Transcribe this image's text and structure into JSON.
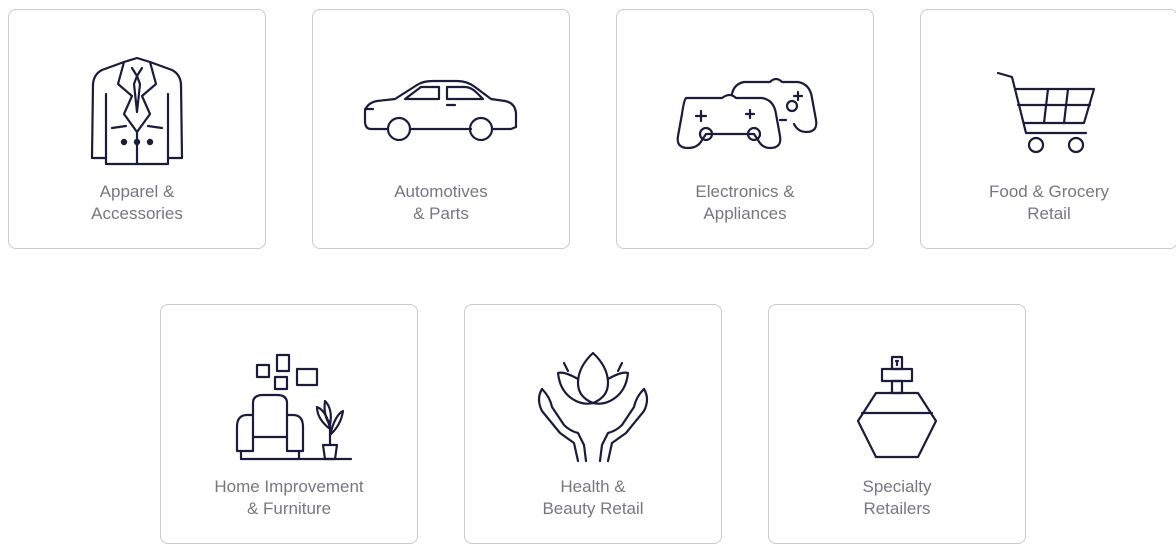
{
  "categories": [
    {
      "icon": "suit-jacket-icon",
      "line1": "Apparel &",
      "line2": "Accessories"
    },
    {
      "icon": "car-icon",
      "line1": "Automotives",
      "line2": "& Parts"
    },
    {
      "icon": "game-controllers-icon",
      "line1": "Electronics &",
      "line2": "Appliances"
    },
    {
      "icon": "shopping-cart-icon",
      "line1": "Food & Grocery",
      "line2": "Retail"
    },
    {
      "icon": "armchair-plant-icon",
      "line1": "Home Improvement",
      "line2": "& Furniture"
    },
    {
      "icon": "lotus-hands-icon",
      "line1": "Health &",
      "line2": "Beauty Retail"
    },
    {
      "icon": "perfume-bottle-icon",
      "line1": "Specialty",
      "line2": "Retailers"
    }
  ],
  "colors": {
    "icon_stroke": "#1b1b3a",
    "label_text": "#77777f",
    "card_border": "#c9c9cf"
  }
}
